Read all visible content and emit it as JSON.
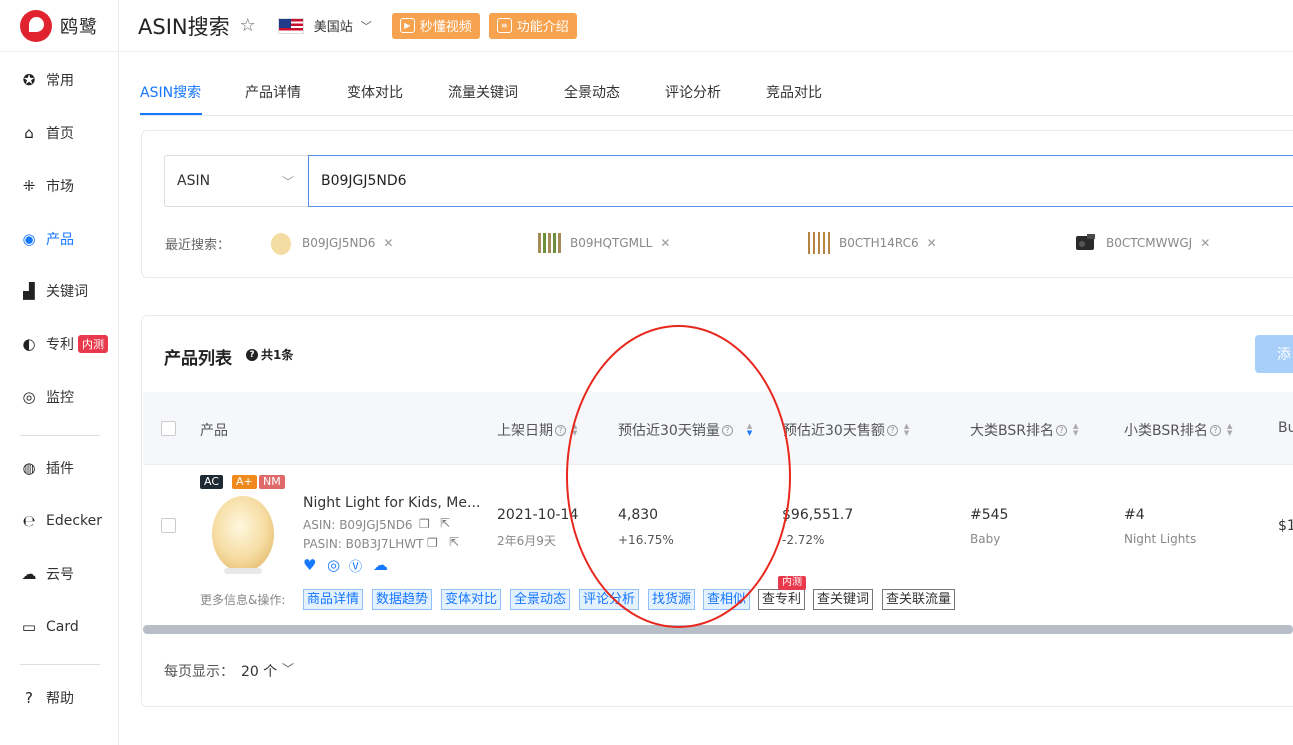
{
  "app": {
    "name": "鸥鹭",
    "page_title": "ASIN搜索",
    "site": "美国站"
  },
  "header_buttons": {
    "video": "秒懂视频",
    "intro": "功能介绍"
  },
  "sidebar": {
    "items": [
      {
        "label": "常用",
        "icon": "star-circle-icon"
      },
      {
        "label": "首页",
        "icon": "home-icon"
      },
      {
        "label": "市场",
        "icon": "grid-icon"
      },
      {
        "label": "产品",
        "icon": "eye-icon",
        "active": true
      },
      {
        "label": "关键词",
        "icon": "bar-chart-icon"
      },
      {
        "label": "专利",
        "icon": "patent-icon",
        "badge": "内测"
      },
      {
        "label": "监控",
        "icon": "monitor-icon"
      },
      {
        "label": "插件",
        "icon": "chrome-icon"
      },
      {
        "label": "Edecker",
        "icon": "edecker-icon"
      },
      {
        "label": "云号",
        "icon": "cloud-icon"
      },
      {
        "label": "Card",
        "icon": "card-icon"
      },
      {
        "label": "帮助",
        "icon": "help-icon"
      }
    ]
  },
  "tabs": [
    "ASIN搜索",
    "产品详情",
    "变体对比",
    "流量关键词",
    "全景动态",
    "评论分析",
    "竞品对比"
  ],
  "search": {
    "type": "ASIN",
    "value": "B09JGJ5ND6",
    "recent_label": "最近搜索：",
    "recent": [
      "B09JGJ5ND6",
      "B09HQTGMLL",
      "B0CTH14RC6",
      "B0CTCMWWGJ"
    ]
  },
  "list": {
    "title": "产品列表",
    "count": "共1条",
    "add_button": "添",
    "columns": [
      "产品",
      "上架日期",
      "预估近30天销量",
      "预估近30天售额",
      "大类BSR排名",
      "小类BSR排名",
      "Bu"
    ],
    "row": {
      "tags": [
        "AC",
        "A+",
        "NM"
      ],
      "title": "Night Light for Kids, Me...",
      "asin": "ASIN: B09JGJ5ND6",
      "pasin": "PASIN: B0B3J7LHWT",
      "date": "2021-10-14",
      "date_age": "2年6月9天",
      "sales": "4,830",
      "sales_change": "+16.75%",
      "revenue": "$96,551.7",
      "revenue_change": "-2.72%",
      "bsr_main": "#545",
      "bsr_main_cat": "Baby",
      "bsr_sub": "#4",
      "bsr_sub_cat": "Night Lights",
      "bu": "$1"
    },
    "ops_label": "更多信息&操作:",
    "ops": [
      "商品详情",
      "数据趋势",
      "变体对比",
      "全景动态",
      "评论分析",
      "找货源",
      "查相似",
      "查专利",
      "查关键词",
      "查关联流量"
    ],
    "ops_badge": "内测",
    "pager_label": "每页显示：",
    "pager_value": "20 个"
  },
  "colors": {
    "accent": "#1677ff",
    "orange": "#f7a24e",
    "red": "#e8394d",
    "annotation": "#e8271d"
  }
}
